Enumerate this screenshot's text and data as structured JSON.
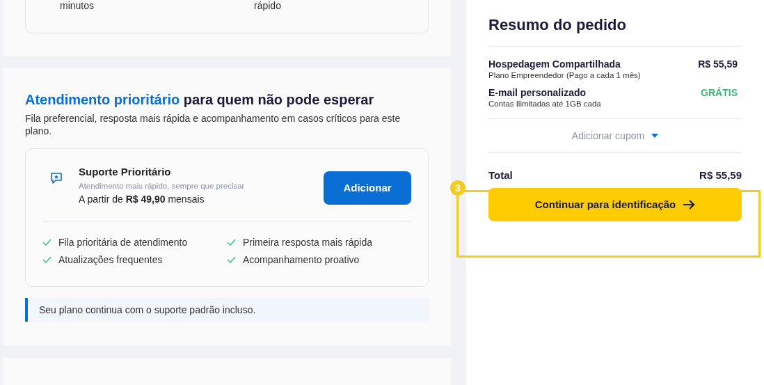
{
  "top_card": {
    "texts": [
      "minutos",
      "rápido"
    ]
  },
  "priority_section": {
    "title_highlight": "Atendimento prioritário",
    "title_rest": "para quem não pode esperar",
    "description": "Fila preferencial, resposta mais rápida e acompanhamento em casos críticos para este plano.",
    "addon": {
      "name": "Suporte Prioritário",
      "subtitle": "Atendimento mais rápido, sempre que precisar",
      "price_line": "A partir de **R$ 49,90** mensais",
      "button": "Adicionar",
      "features": [
        "Fila prioritária de atendimento",
        "Primeira resposta mais rápida",
        "Atualizações frequentes",
        "Acompanhamento proativo"
      ]
    },
    "notice": "Seu plano continua com o suporte padrão incluso."
  },
  "summary": {
    "title": "Resumo do pedido",
    "items": [
      {
        "name": "Hospedagem Compartilhada",
        "detail": "Plano Empreendedor (Pago a cada 1 mês)",
        "price": "R$ 55,59",
        "kind": "paid"
      },
      {
        "name": "E-mail personalizado",
        "detail": "Contas Ilimitadas até 1GB cada",
        "price": "GRÁTIS",
        "kind": "free"
      }
    ],
    "coupon": "Adicionar cupom",
    "total_label": "Total",
    "total_value": "R$ 55,59",
    "button": "Continuar para identificação"
  },
  "annotation": {
    "badge": "3"
  }
}
